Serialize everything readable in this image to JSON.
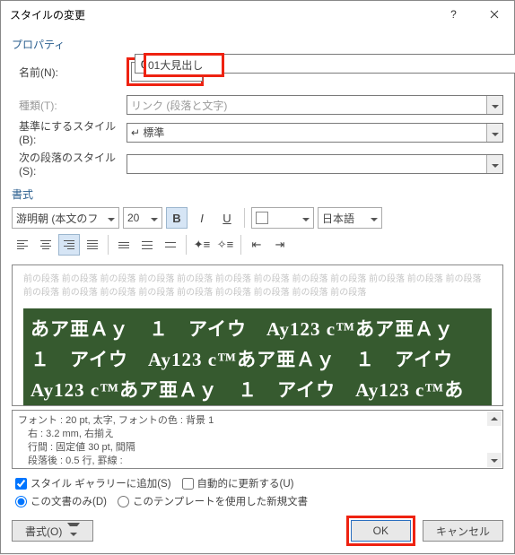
{
  "title": "スタイルの変更",
  "section_properties": "プロパティ",
  "fields": {
    "name_label": "名前(N):",
    "name_value": "01大見出し",
    "type_label": "種類(T):",
    "type_value": "リンク (段落と文字)",
    "base_label": "基準にするスタイル(B):",
    "base_value": "↵ 標準",
    "next_label": "次の段落のスタイル(S):",
    "next_value": ""
  },
  "section_format": "書式",
  "font": {
    "family": "游明朝 (本文のフ",
    "size": "20",
    "lang": "日本語",
    "color": "#ffffff",
    "auto_color": "#000000"
  },
  "btns": {
    "bold": "B",
    "italic": "I",
    "underline": "U"
  },
  "preview_gray": "前の段落 前の段落 前の段落 前の段落 前の段落 前の段落 前の段落 前の段落 前の段落 前の段落 前の段落 前の段落 前の段落 前の段落 前の段落 前の段落 前の段落 前の段落 前の段落 前の段落 前の段落",
  "preview_sample": "あア亜Ａｙ　１　アイウ　Ay123 c™あア亜Ａｙ　１　アイウ　Ay123 c™あア亜Ａｙ　１　アイウ　Ay123 c™あア亜Ａｙ　１　アイウ　Ay123 c™あ",
  "desc": {
    "l1": "フォント : 20 pt, 太字, フォントの色 : 背景 1",
    "l2": "　右 :  3.2 mm, 右揃え",
    "l3": "　行間 :  固定値 30 pt, 間隔",
    "l4": "　段落後 :  0.5 行, 罫線 :"
  },
  "checks": {
    "add_gallery": "スタイル ギャラリーに追加(S)",
    "auto_update": "自動的に更新する(U)",
    "this_doc": "この文書のみ(D)",
    "template": "このテンプレートを使用した新規文書"
  },
  "buttons": {
    "format": "書式(O)",
    "ok": "OK",
    "cancel": "キャンセル"
  }
}
